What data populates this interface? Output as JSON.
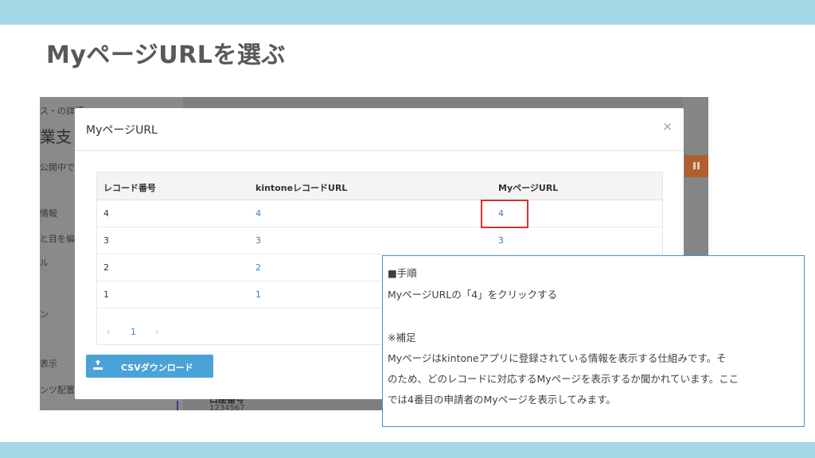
{
  "slide": {
    "title": "MyページURLを選ぶ"
  },
  "background_page": {
    "texts": [
      "ス・の詳細",
      "業支",
      "公開中で",
      "情報",
      "と目を編",
      "ル",
      "ン",
      "表示",
      "ンツ配置",
      "口座番号",
      "1234567"
    ]
  },
  "modal": {
    "title": "MyページURL",
    "close_glyph": "×",
    "table": {
      "columns": [
        "レコード番号",
        "kintoneレコードURL",
        "MyページURL"
      ],
      "rows": [
        {
          "record": "4",
          "kintone_url": "4",
          "mypage_url": "4"
        },
        {
          "record": "3",
          "kintone_url": "3",
          "mypage_url": "3"
        },
        {
          "record": "2",
          "kintone_url": "2",
          "mypage_url": ""
        },
        {
          "record": "1",
          "kintone_url": "1",
          "mypage_url": ""
        }
      ]
    },
    "pager": {
      "prev": "‹",
      "page": "1",
      "next": "›"
    },
    "csv_button": {
      "label": "CSVダウンロード",
      "icon": "download-icon"
    }
  },
  "note": {
    "lines": [
      "■手順",
      "MyページURLの「4」をクリックする",
      "",
      "※補足",
      "Myページはkintoneアプリに登録されている情報を表示する仕組みです。そ",
      "のため、どのレコードに対応するMyページを表示するか聞かれています。ここ",
      "では4番目の申請者のMyページを表示してみます。"
    ]
  },
  "colors": {
    "band": "#a3d7e6",
    "link": "#3a7fbf",
    "button": "#4aa3d6",
    "highlight": "#d9302c",
    "note_border": "#4f90c8"
  }
}
